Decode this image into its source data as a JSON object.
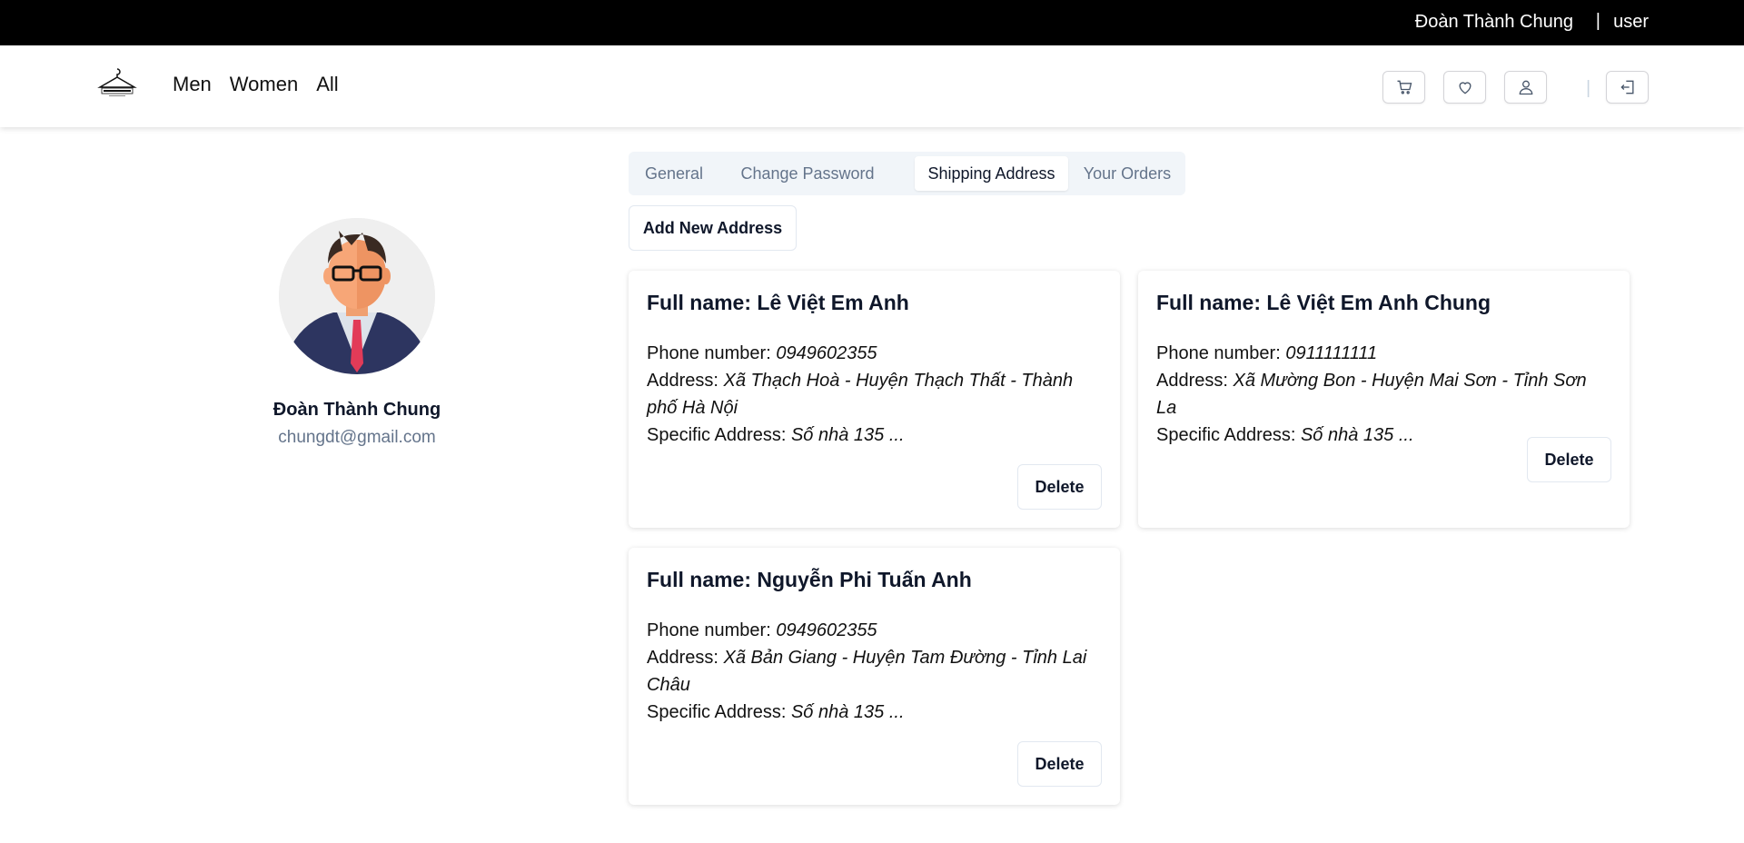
{
  "topbar": {
    "user_name": "Đoàn Thành Chung",
    "separator": "|",
    "role": "user"
  },
  "header": {
    "nav": [
      "Men",
      "Women",
      "All"
    ],
    "icons": [
      "cart-icon",
      "heart-icon",
      "user-icon",
      "logout-icon"
    ],
    "divider": "|"
  },
  "profile": {
    "name": "Đoàn Thành Chung",
    "email": "chungdt@gmail.com"
  },
  "tabs": [
    {
      "label": "General",
      "active": false
    },
    {
      "label": "Change Password",
      "active": false
    },
    {
      "label": "Shipping Address",
      "active": true
    },
    {
      "label": "Your Orders",
      "active": false
    }
  ],
  "add_button": "Add New Address",
  "addresses": [
    {
      "title": "Full name: Lê Việt Em Anh",
      "phone_label": "Phone number: ",
      "phone": "0949602355",
      "address_label": "Address: ",
      "address": "Xã Thạch Hoà - Huyện Thạch Thất - Thành phố Hà Nội",
      "specific_label": "Specific Address: ",
      "specific": "Số nhà 135 ...",
      "delete_label": "Delete"
    },
    {
      "title": "Full name: Lê Việt Em Anh Chung",
      "phone_label": "Phone number: ",
      "phone": "0911111111",
      "address_label": "Address: ",
      "address": "Xã Mường Bon - Huyện Mai Sơn - Tỉnh Sơn La",
      "specific_label": "Specific Address: ",
      "specific": "Số nhà 135 ...",
      "delete_label": "Delete"
    },
    {
      "title": "Full name: Nguyễn Phi Tuấn Anh",
      "phone_label": "Phone number: ",
      "phone": "0949602355",
      "address_label": "Address: ",
      "address": "Xã Bản Giang - Huyện Tam Đường - Tỉnh Lai Châu",
      "specific_label": "Specific Address: ",
      "specific": "Số nhà 135 ...",
      "delete_label": "Delete"
    }
  ]
}
